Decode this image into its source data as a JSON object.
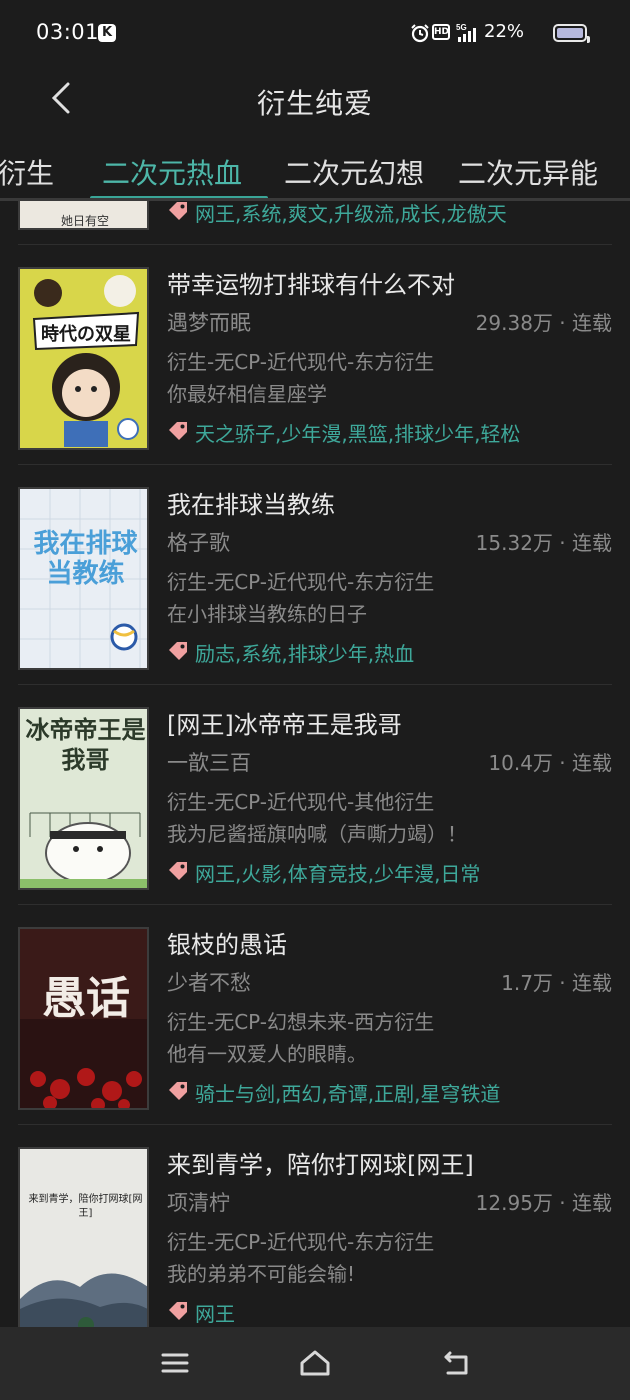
{
  "status": {
    "time": "03:01",
    "badge": "K",
    "hd": "HD",
    "battery": "22%"
  },
  "header": {
    "title": "衍生纯爱"
  },
  "tabs": [
    {
      "label": "方衍生"
    },
    {
      "label": "二次元热血"
    },
    {
      "label": "二次元幻想"
    },
    {
      "label": "二次元异能"
    }
  ],
  "partial": {
    "cover_text": "她日有空",
    "tags": "网王,系统,爽文,升级流,成长,龙傲天"
  },
  "books": [
    {
      "title": "带幸运物打排球有什么不对",
      "author": "遇梦而眠",
      "stats": "29.38万 · 连载",
      "category": "衍生-无CP-近代现代-东方衍生",
      "intro": "你最好相信星座学",
      "tags": "天之骄子,少年漫,黑篮,排球少年,轻松",
      "cover_text": "時代の双星"
    },
    {
      "title": "我在排球当教练",
      "author": "格子歌",
      "stats": "15.32万 · 连载",
      "category": "衍生-无CP-近代现代-东方衍生",
      "intro": "在小排球当教练的日子",
      "tags": "励志,系统,排球少年,热血",
      "cover_text": "我在排球当教练"
    },
    {
      "title": "[网王]冰帝帝王是我哥",
      "author": "一歆三百",
      "stats": "10.4万 · 连载",
      "category": "衍生-无CP-近代现代-其他衍生",
      "intro": "我为尼酱摇旗呐喊（声嘶力竭）！",
      "tags": "网王,火影,体育竞技,少年漫,日常",
      "cover_text": "冰帝帝王是我哥"
    },
    {
      "title": "银枝的愚话",
      "author": "少者不愁",
      "stats": "1.7万 · 连载",
      "category": "衍生-无CP-幻想未来-西方衍生",
      "intro": "他有一双爱人的眼睛。",
      "tags": "骑士与剑,西幻,奇谭,正剧,星穹铁道",
      "cover_text": "愚话"
    },
    {
      "title": "来到青学，陪你打网球[网王]",
      "author": "项清柠",
      "stats": "12.95万 · 连载",
      "category": "衍生-无CP-近代现代-东方衍生",
      "intro": "我的弟弟不可能会输!",
      "tags": "网王",
      "cover_text": "来到青学，陪你打网球[网王]"
    }
  ],
  "colors": {
    "background": "#1c1c1c",
    "accent": "#3ea89a",
    "tag_icon": "#f0a0a0",
    "secondary_text": "#8a8a8a"
  }
}
